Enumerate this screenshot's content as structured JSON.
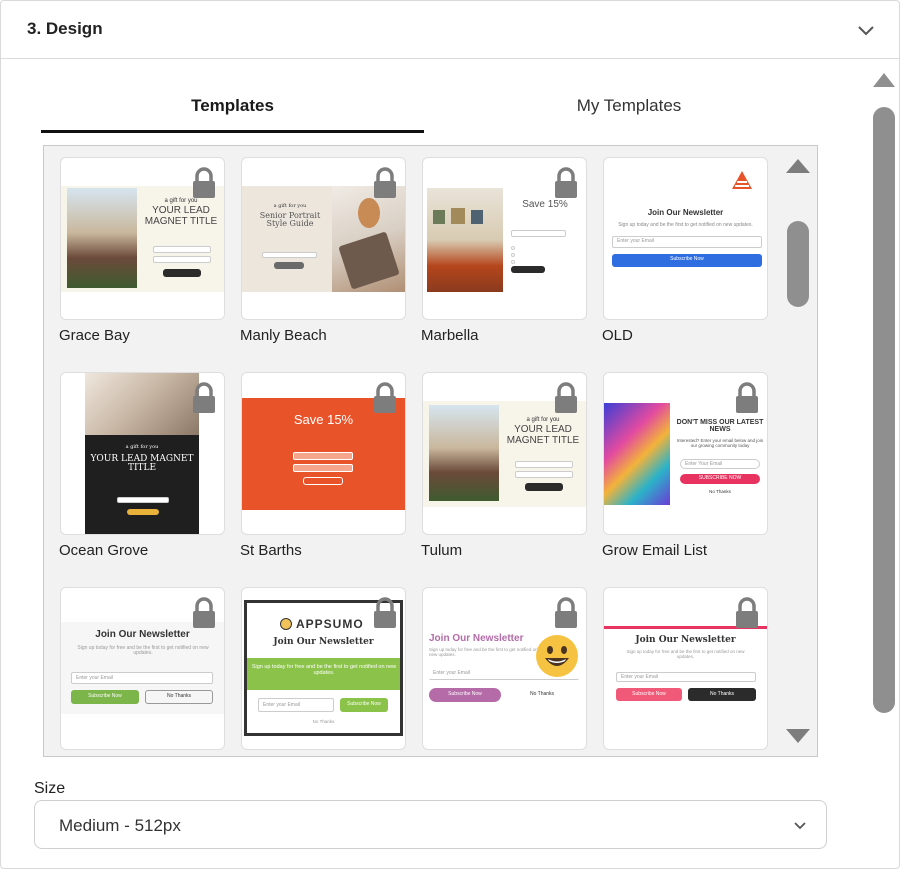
{
  "section": {
    "title": "3. Design"
  },
  "tabs": [
    {
      "label": "Templates",
      "active": true
    },
    {
      "label": "My Templates",
      "active": false
    }
  ],
  "templates": [
    {
      "name": "Grace Bay",
      "locked": true
    },
    {
      "name": "Manly Beach",
      "locked": true
    },
    {
      "name": "Marbella",
      "locked": true
    },
    {
      "name": "OLD",
      "locked": false
    },
    {
      "name": "Ocean Grove",
      "locked": true
    },
    {
      "name": "St Barths",
      "locked": true
    },
    {
      "name": "Tulum",
      "locked": true
    },
    {
      "name": "Grow Email List",
      "locked": true
    },
    {
      "name": "",
      "locked": true
    },
    {
      "name": "",
      "locked": true
    },
    {
      "name": "",
      "locked": true
    },
    {
      "name": "",
      "locked": true
    }
  ],
  "previews": {
    "grace_bay": {
      "small": "a gift for you",
      "title": "YOUR LEAD MAGNET TITLE"
    },
    "manly_beach": {
      "small": "a gift for you",
      "title": "Senior Portrait Style Guide"
    },
    "marbella": {
      "title": "Save 15%"
    },
    "old": {
      "title": "Join Our Newsletter",
      "sub": "Sign up today and be the first to get notified on new updates.",
      "field": "Enter your Email",
      "button": "Subscribe Now"
    },
    "ocean_grove": {
      "small": "a gift for you",
      "title": "YOUR LEAD MAGNET TITLE"
    },
    "st_barths": {
      "title": "Save 15%"
    },
    "tulum": {
      "small": "a gift for you",
      "title": "YOUR LEAD MAGNET TITLE"
    },
    "grow": {
      "title": "DON'T MISS OUR LATEST NEWS",
      "sub": "Interested? Enter your email below and join our growing community today",
      "field": "Enter Your Email",
      "button": "SUBSCRIBE NOW",
      "no": "No Thanks"
    },
    "row3_a": {
      "title": "Join Our Newsletter",
      "sub": "Sign up today for free and be the first to get notified on new updates.",
      "field": "Enter your Email",
      "button": "Subscribe Now",
      "no": "No Thanks"
    },
    "row3_b": {
      "brand": "APPSUMO",
      "title": "Join Our Newsletter",
      "sub": "Sign up today for free and be the first to get notified on new updates.",
      "field": "Enter your Email",
      "button": "Subscribe Now",
      "no": "No Thanks"
    },
    "row3_c": {
      "title": "Join Our Newsletter",
      "sub": "Sign up today for free and be the first to get notified on new updates.",
      "field": "Enter your Email",
      "button": "Subscribe Now",
      "no": "No Thanks"
    },
    "row3_d": {
      "title": "Join Our Newsletter",
      "sub": "Sign up today for free and be the first to get notified on new updates.",
      "field": "Enter your Email",
      "button": "Subscribe Now",
      "no": "No Thanks"
    }
  },
  "size": {
    "label": "Size",
    "value": "Medium - 512px"
  },
  "colors": {
    "orange": "#e8532a",
    "blue": "#2f6ee0",
    "green": "#7cb54a",
    "pink": "#e8325f",
    "purple": "#b56ba8",
    "dark": "#1f1f1f",
    "scrollbar": "#8f8f8f"
  }
}
